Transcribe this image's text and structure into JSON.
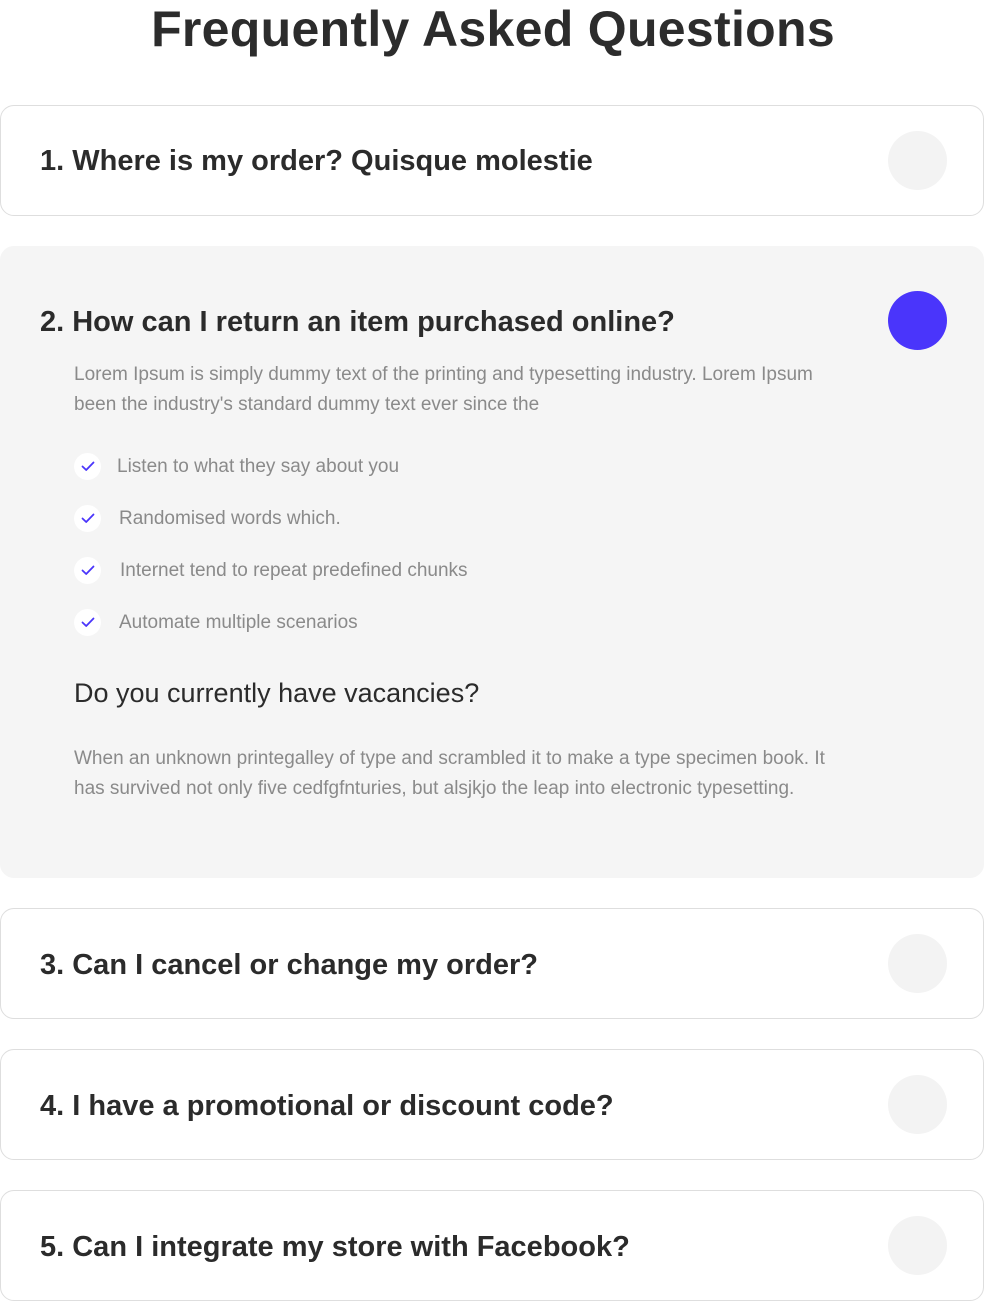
{
  "page": {
    "title": "Frequently Asked Questions"
  },
  "faq": [
    {
      "question": "1. Where is my order? Quisque molestie",
      "expanded": false
    },
    {
      "question": "2. How can I return an item purchased online?",
      "expanded": true,
      "answer": "Lorem Ipsum is simply dummy text of the printing and typesetting industry. Lorem Ipsum been the industry's standard dummy text ever since the",
      "checklist": [
        "Listen to what they say about you",
        "Randomised words which.",
        "Internet tend to repeat predefined chunks",
        "Automate multiple scenarios"
      ],
      "sub_question": "Do you currently have vacancies?",
      "sub_answer": "When an unknown printegalley of type and scrambled it to make a type specimen book. It has survived not only five cedfgfnturies, but alsjkjo the leap into electronic typesetting."
    },
    {
      "question": "3. Can I cancel or change my order?",
      "expanded": false
    },
    {
      "question": "4. I have a promotional or discount code?",
      "expanded": false
    },
    {
      "question": "5. Can I integrate my store with Facebook?",
      "expanded": false
    }
  ],
  "colors": {
    "accent": "#4a35fb",
    "toggle_inactive": "#f3f3f3",
    "open_panel_bg": "#f5f5f5",
    "heading_text": "#2b2b2b",
    "body_text": "#8a8a8a",
    "card_border": "#dedede"
  },
  "icons": {
    "toggle": "circle-toggle-icon",
    "check": "check-icon"
  }
}
